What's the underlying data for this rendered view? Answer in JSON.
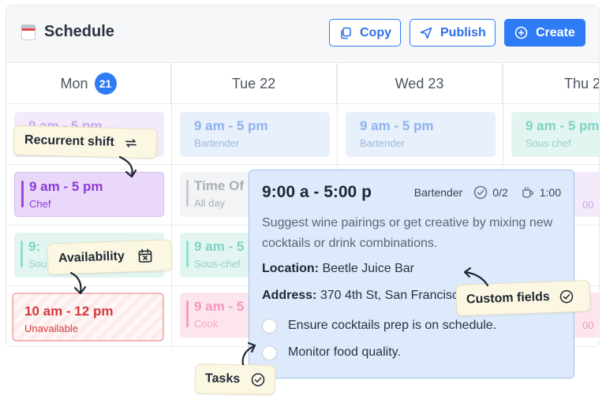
{
  "header": {
    "title": "Schedule",
    "copy_label": "Copy",
    "publish_label": "Publish",
    "create_label": "Create"
  },
  "days": [
    {
      "name": "Mon",
      "date_badge": "21"
    },
    {
      "name": "Tue 22"
    },
    {
      "name": "Wed 23"
    },
    {
      "name": "Thu 2"
    }
  ],
  "shifts": {
    "mon_row1": {
      "time": "9 am - 5 pm"
    },
    "mon_row2": {
      "time": "9 am - 5 pm",
      "role": "Chef"
    },
    "mon_row3": {
      "time": "9:",
      "role": "Sou"
    },
    "mon_row4": {
      "time": "10 am - 12 pm",
      "role": "Unavailable"
    },
    "tue_row1": {
      "time": "9 am - 5 pm",
      "role": "Bartender"
    },
    "tue_row2": {
      "time": "Time Of",
      "role": "All day"
    },
    "tue_row3": {
      "time": "9 am - 5",
      "role": "Sous-chef"
    },
    "tue_row4": {
      "time": "9 am - 5",
      "role": "Cook"
    },
    "wed_row1": {
      "time": "9 am - 5 pm",
      "role": "Bartender"
    },
    "thu_row1": {
      "time": "9 am - 5 pm",
      "role": "Sous chef"
    },
    "thu_row2": {
      "time": "00"
    },
    "thu_row4": {
      "time": "00"
    }
  },
  "popover": {
    "time": "9:00 a - 5:00 p",
    "role": "Bartender",
    "tasks_count": "0/2",
    "break_time": "1:00",
    "description": "Suggest wine pairings or get creative by mixing new cocktails or drink combinations.",
    "location_label": "Location:",
    "location_value": "Beetle Juice Bar",
    "address_label": "Address:",
    "address_value": "370 4th St, San Francisco",
    "tasks": [
      "Ensure cocktails prep is on schedule.",
      "Monitor food quality."
    ]
  },
  "callouts": {
    "recurrent": "Recurrent shift",
    "availability": "Availability",
    "custom_fields": "Custom fields",
    "tasks": "Tasks"
  },
  "colors": {
    "accent": "#2f7bf6",
    "callout_bg": "#fbf7e3",
    "popover_bg": "#ddeafc",
    "unavailable": "#d23a3a"
  }
}
